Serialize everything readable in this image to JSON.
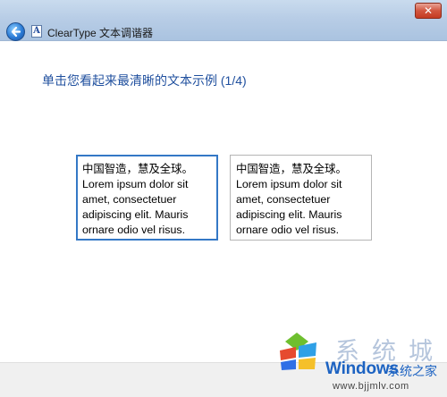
{
  "window": {
    "title": "ClearType 文本调谐器",
    "close_glyph": "✕",
    "app_icon_letter": "A"
  },
  "page": {
    "heading": "单击您看起来最清晰的文本示例 (1/4)"
  },
  "samples": [
    {
      "lines": [
        "中国智造，慧及全球。",
        "Lorem ipsum dolor sit",
        "amet, consectetuer",
        "adipiscing elit. Mauris",
        "ornare odio vel risus."
      ],
      "selected": true
    },
    {
      "lines": [
        "中国智造，慧及全球。",
        "Lorem ipsum dolor sit",
        "amet, consectetuer",
        "adipiscing elit. Mauris",
        "ornare odio vel risus."
      ],
      "selected": false
    }
  ],
  "watermark": {
    "partial_text": "系统城",
    "brand": "Windows",
    "brand_cn": "系统之家",
    "url": "www.bjjmlv.com"
  },
  "colors": {
    "heading": "#1f4f9e",
    "selected_border": "#3478c6",
    "titlebar": "#b8cde6"
  }
}
